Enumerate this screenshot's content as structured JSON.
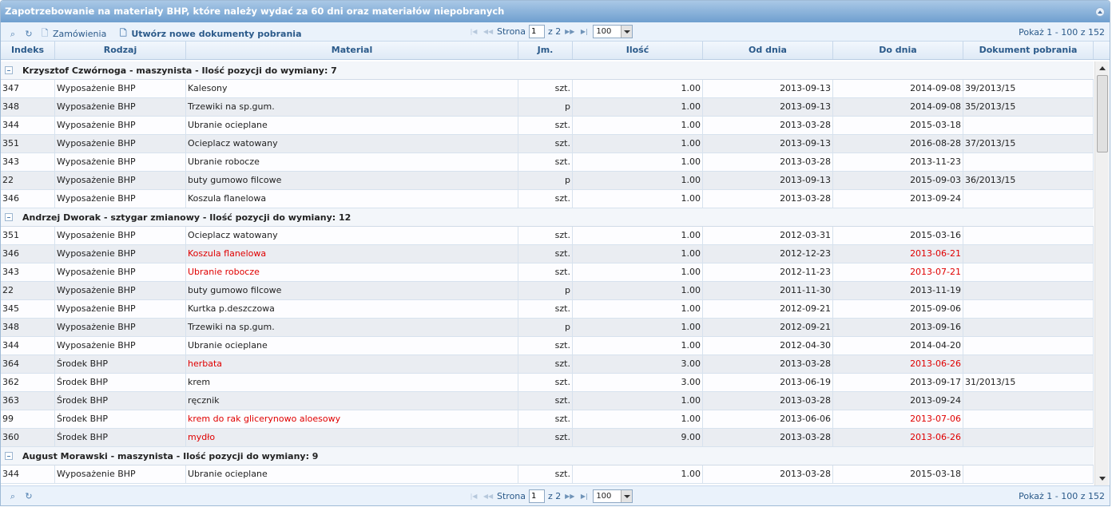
{
  "title": "Zapotrzebowanie na materiały BHP, które należy wydać za 60 dni oraz materiałów niepobranych",
  "toolbar": {
    "orders_label": "Zamówienia",
    "create_label": "Utwórz nowe dokumenty pobrania",
    "page_label": "Strona",
    "page_value": "1",
    "of_label": "z 2",
    "rows_value": "100",
    "view_info": "Pokaż 1 - 100 z 152"
  },
  "columns": [
    "Indeks",
    "Rodzaj",
    "Material",
    "Jm.",
    "Ilość",
    "Od dnia",
    "Do dnia",
    "Dokument pobrania"
  ],
  "groups": [
    {
      "label": "Krzysztof Czwórnoga - maszynista - Ilość pozycji do wymiany: 7",
      "rows": [
        {
          "idx": "347",
          "type": "Wyposażenie BHP",
          "mat": "Kalesony",
          "unit": "szt.",
          "qty": "1.00",
          "from": "2013-09-13",
          "to": "2014-09-08",
          "doc": "39/2013/15",
          "warn": false
        },
        {
          "idx": "348",
          "type": "Wyposażenie BHP",
          "mat": "Trzewiki na sp.gum.",
          "unit": "p",
          "qty": "1.00",
          "from": "2013-09-13",
          "to": "2014-09-08",
          "doc": "35/2013/15",
          "warn": false
        },
        {
          "idx": "344",
          "type": "Wyposażenie BHP",
          "mat": "Ubranie ocieplane",
          "unit": "szt.",
          "qty": "1.00",
          "from": "2013-03-28",
          "to": "2015-03-18",
          "doc": "",
          "warn": false
        },
        {
          "idx": "351",
          "type": "Wyposażenie BHP",
          "mat": "Ocieplacz watowany",
          "unit": "szt.",
          "qty": "1.00",
          "from": "2013-09-13",
          "to": "2016-08-28",
          "doc": "37/2013/15",
          "warn": false
        },
        {
          "idx": "343",
          "type": "Wyposażenie BHP",
          "mat": "Ubranie robocze",
          "unit": "szt.",
          "qty": "1.00",
          "from": "2013-03-28",
          "to": "2013-11-23",
          "doc": "",
          "warn": false
        },
        {
          "idx": "22",
          "type": "Wyposażenie BHP",
          "mat": "buty gumowo filcowe",
          "unit": "p",
          "qty": "1.00",
          "from": "2013-09-13",
          "to": "2015-09-03",
          "doc": "36/2013/15",
          "warn": false
        },
        {
          "idx": "346",
          "type": "Wyposażenie BHP",
          "mat": "Koszula flanelowa",
          "unit": "szt.",
          "qty": "1.00",
          "from": "2013-03-28",
          "to": "2013-09-24",
          "doc": "",
          "warn": false
        }
      ]
    },
    {
      "label": "Andrzej Dworak - sztygar zmianowy - Ilość pozycji do wymiany: 12",
      "rows": [
        {
          "idx": "351",
          "type": "Wyposażenie BHP",
          "mat": "Ocieplacz watowany",
          "unit": "szt.",
          "qty": "1.00",
          "from": "2012-03-31",
          "to": "2015-03-16",
          "doc": "",
          "warn": false
        },
        {
          "idx": "346",
          "type": "Wyposażenie BHP",
          "mat": "Koszula flanelowa",
          "unit": "szt.",
          "qty": "1.00",
          "from": "2012-12-23",
          "to": "2013-06-21",
          "doc": "",
          "warn": true
        },
        {
          "idx": "343",
          "type": "Wyposażenie BHP",
          "mat": "Ubranie robocze",
          "unit": "szt.",
          "qty": "1.00",
          "from": "2012-11-23",
          "to": "2013-07-21",
          "doc": "",
          "warn": true
        },
        {
          "idx": "22",
          "type": "Wyposażenie BHP",
          "mat": "buty gumowo filcowe",
          "unit": "p",
          "qty": "1.00",
          "from": "2011-11-30",
          "to": "2013-11-19",
          "doc": "",
          "warn": false
        },
        {
          "idx": "345",
          "type": "Wyposażenie BHP",
          "mat": "Kurtka p.deszczowa",
          "unit": "szt.",
          "qty": "1.00",
          "from": "2012-09-21",
          "to": "2015-09-06",
          "doc": "",
          "warn": false
        },
        {
          "idx": "348",
          "type": "Wyposażenie BHP",
          "mat": "Trzewiki na sp.gum.",
          "unit": "p",
          "qty": "1.00",
          "from": "2012-09-21",
          "to": "2013-09-16",
          "doc": "",
          "warn": false
        },
        {
          "idx": "344",
          "type": "Wyposażenie BHP",
          "mat": "Ubranie ocieplane",
          "unit": "szt.",
          "qty": "1.00",
          "from": "2012-04-30",
          "to": "2014-04-20",
          "doc": "",
          "warn": false
        },
        {
          "idx": "364",
          "type": "Środek BHP",
          "mat": "herbata",
          "unit": "szt.",
          "qty": "3.00",
          "from": "2013-03-28",
          "to": "2013-06-26",
          "doc": "",
          "warn": true
        },
        {
          "idx": "362",
          "type": "Środek BHP",
          "mat": "krem",
          "unit": "szt.",
          "qty": "3.00",
          "from": "2013-06-19",
          "to": "2013-09-17",
          "doc": "31/2013/15",
          "warn": false
        },
        {
          "idx": "363",
          "type": "Środek BHP",
          "mat": "ręcznik",
          "unit": "szt.",
          "qty": "1.00",
          "from": "2013-03-28",
          "to": "2013-09-24",
          "doc": "",
          "warn": false
        },
        {
          "idx": "99",
          "type": "Środek BHP",
          "mat": "krem do rak glicerynowo aloesowy",
          "unit": "szt.",
          "qty": "1.00",
          "from": "2013-06-06",
          "to": "2013-07-06",
          "doc": "",
          "warn": true
        },
        {
          "idx": "360",
          "type": "Środek BHP",
          "mat": "mydło",
          "unit": "szt.",
          "qty": "9.00",
          "from": "2013-03-28",
          "to": "2013-06-26",
          "doc": "",
          "warn": true
        }
      ]
    },
    {
      "label": "August Morawski - maszynista - Ilość pozycji do wymiany: 9",
      "rows": [
        {
          "idx": "344",
          "type": "Wyposażenie BHP",
          "mat": "Ubranie ocieplane",
          "unit": "szt.",
          "qty": "1.00",
          "from": "2013-03-28",
          "to": "2015-03-18",
          "doc": "",
          "warn": false
        }
      ]
    }
  ]
}
